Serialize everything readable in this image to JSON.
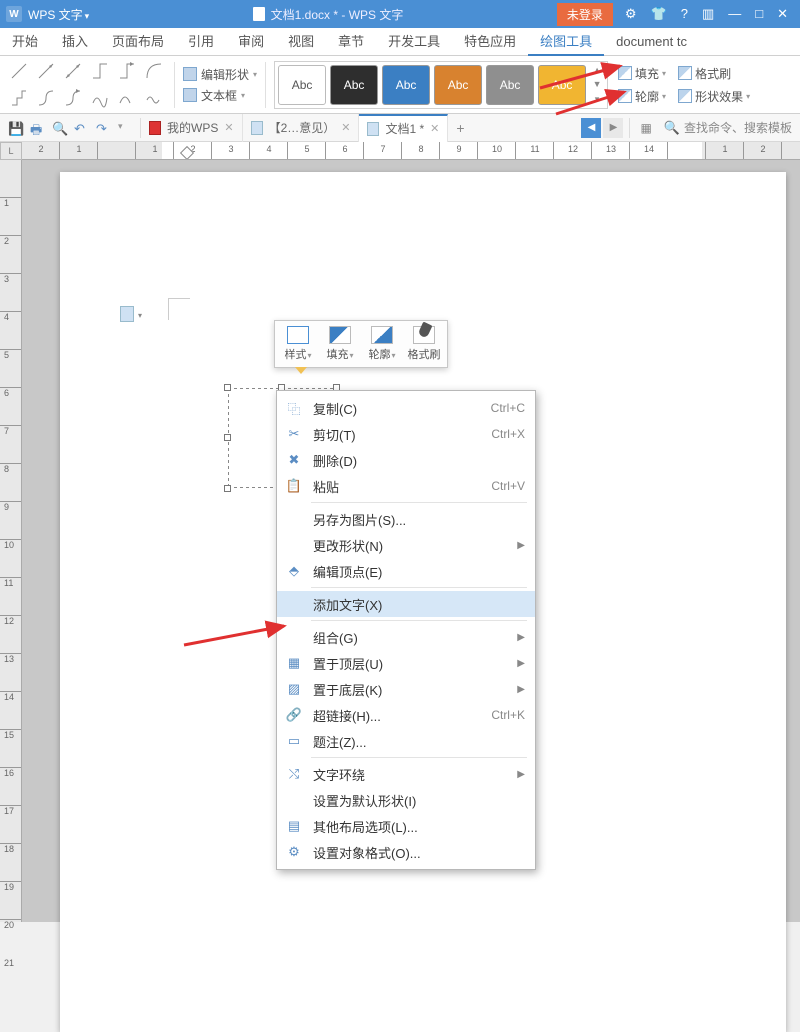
{
  "titlebar": {
    "app_name": "WPS 文字",
    "doc_title": "文档1.docx * - WPS 文字",
    "login": "未登录",
    "win_icons": [
      "settings",
      "skin",
      "help",
      "menu",
      "min",
      "max",
      "close"
    ]
  },
  "ribbon": {
    "tabs": [
      "开始",
      "插入",
      "页面布局",
      "引用",
      "审阅",
      "视图",
      "章节",
      "开发工具",
      "特色应用",
      "绘图工具",
      "document tc"
    ],
    "active_tab": "绘图工具",
    "edit_shape": "编辑形状",
    "text_box": "文本框",
    "styles_label": "Abc",
    "style_colors": [
      "#ffffff",
      "#2e2e2e",
      "#3b7fc3",
      "#d8822f",
      "#8f8f8f",
      "#f1b531"
    ],
    "fill": "填充",
    "outline": "轮廓",
    "format_painter": "格式刷",
    "shape_effect": "形状效果"
  },
  "doctabs": {
    "mywps": "我的WPS",
    "tab2": "【2…意见）",
    "tab3": "文档1 *",
    "search_placeholder": "查找命令、搜索模板"
  },
  "ruler": {
    "h_labels": [
      "2",
      "1",
      "",
      "1",
      "2",
      "3",
      "4",
      "5",
      "6",
      "7",
      "8",
      "9",
      "10",
      "11",
      "12",
      "13",
      "14",
      "",
      "1",
      "2"
    ],
    "v_labels": [
      "",
      "1",
      "2",
      "3",
      "4",
      "5",
      "6",
      "7",
      "8",
      "9",
      "10",
      "11",
      "12",
      "13",
      "14",
      "15",
      "16",
      "17",
      "18",
      "19",
      "20",
      "21"
    ],
    "corner": "L"
  },
  "mini_toolbar": {
    "items": [
      {
        "label": "样式",
        "dd": true
      },
      {
        "label": "填充",
        "dd": true
      },
      {
        "label": "轮廓",
        "dd": true
      },
      {
        "label": "格式刷",
        "dd": false
      }
    ]
  },
  "context_menu": {
    "items": [
      {
        "icon": "copy",
        "label": "复制(C)",
        "shortcut": "Ctrl+C"
      },
      {
        "icon": "cut",
        "label": "剪切(T)",
        "shortcut": "Ctrl+X"
      },
      {
        "icon": "delete",
        "label": "删除(D)",
        "shortcut": ""
      },
      {
        "icon": "paste",
        "label": "粘贴",
        "shortcut": "Ctrl+V"
      },
      {
        "sep": true
      },
      {
        "icon": "",
        "label": "另存为图片(S)...",
        "shortcut": ""
      },
      {
        "icon": "",
        "label": "更改形状(N)",
        "sub": true
      },
      {
        "icon": "edit-points",
        "label": "编辑顶点(E)",
        "shortcut": ""
      },
      {
        "sep": true
      },
      {
        "icon": "",
        "label": "添加文字(X)",
        "shortcut": "",
        "hover": true
      },
      {
        "sep": true
      },
      {
        "icon": "",
        "label": "组合(G)",
        "sub": true
      },
      {
        "icon": "bring-front",
        "label": "置于顶层(U)",
        "sub": true
      },
      {
        "icon": "send-back",
        "label": "置于底层(K)",
        "sub": true
      },
      {
        "icon": "link",
        "label": "超链接(H)...",
        "shortcut": "Ctrl+K"
      },
      {
        "icon": "caption",
        "label": "题注(Z)...",
        "shortcut": ""
      },
      {
        "sep": true
      },
      {
        "icon": "wrap",
        "label": "文字环绕",
        "sub": true
      },
      {
        "icon": "",
        "label": "设置为默认形状(I)",
        "shortcut": ""
      },
      {
        "icon": "layout",
        "label": "其他布局选项(L)...",
        "shortcut": ""
      },
      {
        "icon": "format",
        "label": "设置对象格式(O)...",
        "shortcut": ""
      }
    ]
  }
}
